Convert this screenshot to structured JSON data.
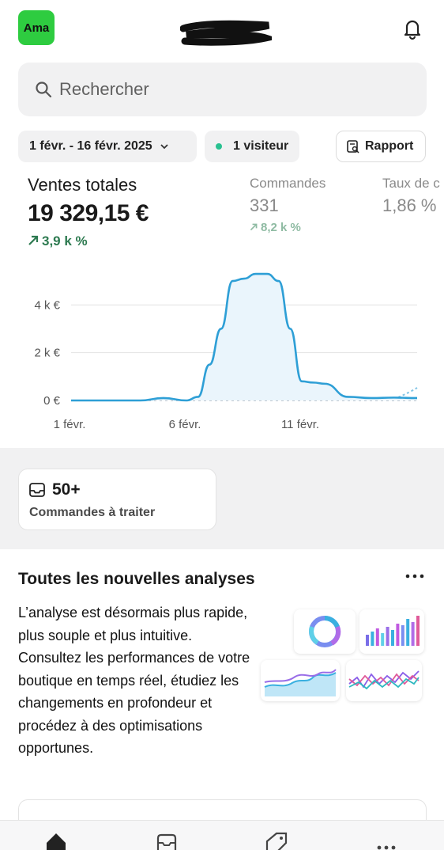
{
  "header": {
    "avatar_text": "Ama",
    "brand_color": "#2ecc40"
  },
  "search": {
    "placeholder": "Rechercher"
  },
  "filters": {
    "date_range": "1 févr. - 16 févr. 2025",
    "visitors": "1 visiteur",
    "report_label": "Rapport"
  },
  "metrics": {
    "total_sales": {
      "label": "Ventes totales",
      "value": "19 329,15 €",
      "trend": "3,9 k %"
    },
    "orders": {
      "label": "Commandes",
      "value": "331",
      "trend": "8,2 k %"
    },
    "conversion": {
      "label": "Taux de c",
      "value": "1,86 %"
    }
  },
  "chart_data": {
    "type": "line",
    "x": [
      1,
      2,
      3,
      4,
      5,
      6,
      6.5,
      7,
      7.5,
      8,
      8.5,
      9,
      9.5,
      10,
      10.5,
      11,
      11.5,
      12,
      13,
      14,
      15,
      16
    ],
    "x_tick_labels": [
      "1 févr.",
      "6 févr.",
      "11 févr."
    ],
    "x_tick_values": [
      1,
      6,
      11
    ],
    "y_tick_labels": [
      "0 €",
      "2 k €",
      "4 k €"
    ],
    "y_tick_values": [
      0,
      2000,
      4000
    ],
    "ylim": [
      0,
      5500
    ],
    "xlim": [
      1,
      16
    ],
    "series": [
      {
        "values": [
          0,
          0,
          0,
          0,
          100,
          0,
          150,
          1500,
          3000,
          5000,
          5100,
          5300,
          5300,
          5000,
          3000,
          800,
          750,
          700,
          150,
          100,
          120,
          100
        ],
        "color": "#2e9fd6"
      }
    ],
    "grid": true
  },
  "orders_card": {
    "count": "50+",
    "label": "Commandes à traiter"
  },
  "analyses": {
    "title": "Toutes les nouvelles analyses",
    "body": "L’analyse est désormais plus rapide, plus souple et plus intuitive. Consultez les performances de votre boutique en temps réel, étudiez les changements en profondeur et procédez à des optimisations opportunes."
  },
  "bottom_nav": {
    "items": [
      "home-icon",
      "orders-icon",
      "tag-icon",
      "more-icon"
    ]
  }
}
